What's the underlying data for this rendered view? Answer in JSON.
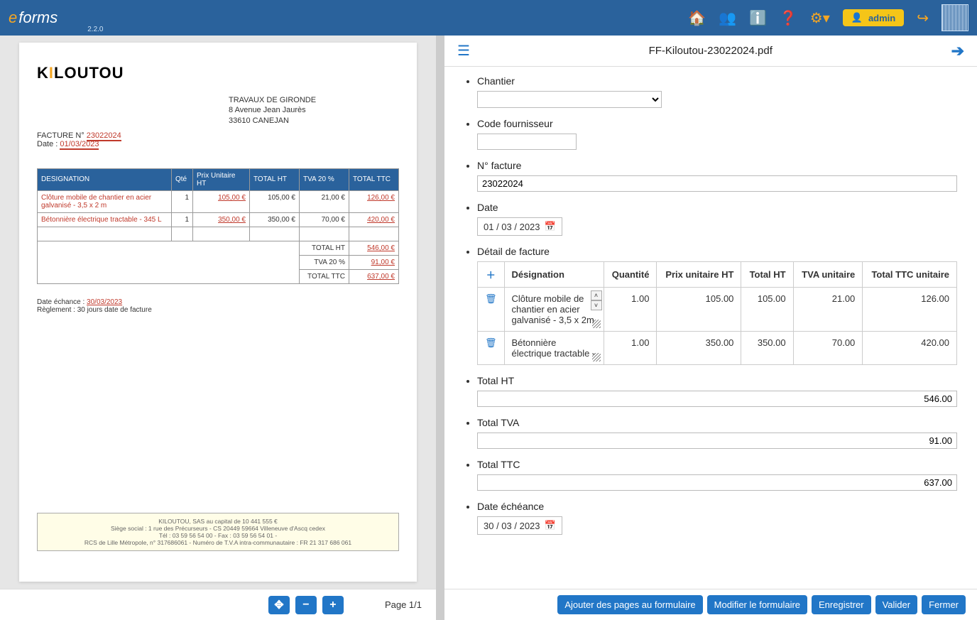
{
  "app": {
    "name_e": "e",
    "name_rest": "forms",
    "version": "2.2.0"
  },
  "topbar": {
    "user_label": "admin"
  },
  "doc": {
    "filename": "FF-Kiloutou-23022024.pdf",
    "brand": "KILOUTOU",
    "addr_l1": "TRAVAUX DE GIRONDE",
    "addr_l2": "8 Avenue Jean Jaurès",
    "addr_l3": "33610 CANEJAN",
    "facture_pre": "FACTURE N° ",
    "facture_num": "23022024",
    "date_pre": "Date : ",
    "date_val": "01/03/2023",
    "th_des": "DESIGNATION",
    "th_qte": "Qté",
    "th_pu": "Prix Unitaire HT",
    "th_tot": "TOTAL HT",
    "th_tva": "TVA 20 %",
    "th_ttc": "TOTAL TTC",
    "r1_des": "Clôture mobile de chantier en acier galvanisé - 3,5 x 2 m",
    "r1_qte": "1",
    "r1_pu": "105,00 €",
    "r1_tot": "105,00 €",
    "r1_tva": "21,00 €",
    "r1_ttc": "126,00 €",
    "r2_des": "Bétonnière électrique tractable - 345 L",
    "r2_qte": "1",
    "r2_pu": "350,00 €",
    "r2_tot": "350,00 €",
    "r2_tva": "70,00 €",
    "r2_ttc": "420,00 €",
    "tot_ht_lbl": "TOTAL HT",
    "tot_ht": "546,00 €",
    "tot_tva_lbl": "TVA 20 %",
    "tot_tva": "91,00 €",
    "tot_ttc_lbl": "TOTAL TTC",
    "tot_ttc": "637,00 €",
    "ech_pre": "Date échance : ",
    "ech_val": "30/03/2023",
    "regl": "Règlement : 30 jours date de facture",
    "foot1": "KILOUTOU, SAS au capital de 10 441 555 €",
    "foot2": "Siège social : 1 rue des Précurseurs - CS 20449 59664 Villeneuve d'Ascq cedex",
    "foot3": "Tél : 03 59 56 54 00 - Fax : 03 59 56 54 01 -",
    "foot4": "RCS de Lille Métropole, n° 317686061 - Numéro de T.V.A intra-communautaire : FR 21 317 686 061"
  },
  "pager": {
    "page_label": "Page 1/1"
  },
  "form": {
    "chantier_lbl": "Chantier",
    "code_four_lbl": "Code fournisseur",
    "nfact_lbl": "N° facture",
    "nfact_val": "23022024",
    "date_lbl": "Date",
    "date_val": "01 / 03 / 2023",
    "detail_lbl": "Détail de facture",
    "det_h_des": "Désignation",
    "det_h_qte": "Quantité",
    "det_h_pu": "Prix unitaire HT",
    "det_h_tot": "Total HT",
    "det_h_tva": "TVA unitaire",
    "det_h_ttc": "Total TTC unitaire",
    "det_r1_des": "Clôture mobile de chantier en acier galvanisé - 3,5 x 2m",
    "det_r1_qte": "1.00",
    "det_r1_pu": "105.00",
    "det_r1_tot": "105.00",
    "det_r1_tva": "21.00",
    "det_r1_ttc": "126.00",
    "det_r2_des": "Bétonnière électrique tractable -",
    "det_r2_qte": "1.00",
    "det_r2_pu": "350.00",
    "det_r2_tot": "350.00",
    "det_r2_tva": "70.00",
    "det_r2_ttc": "420.00",
    "totht_lbl": "Total HT",
    "totht_val": "546.00",
    "tottva_lbl": "Total TVA",
    "tottva_val": "91.00",
    "totttc_lbl": "Total TTC",
    "totttc_val": "637.00",
    "ech_lbl": "Date échéance",
    "ech_val": "30 / 03 / 2023"
  },
  "actions": {
    "add_pages": "Ajouter des pages au formulaire",
    "modify": "Modifier le formulaire",
    "save": "Enregistrer",
    "validate": "Valider",
    "close": "Fermer"
  }
}
